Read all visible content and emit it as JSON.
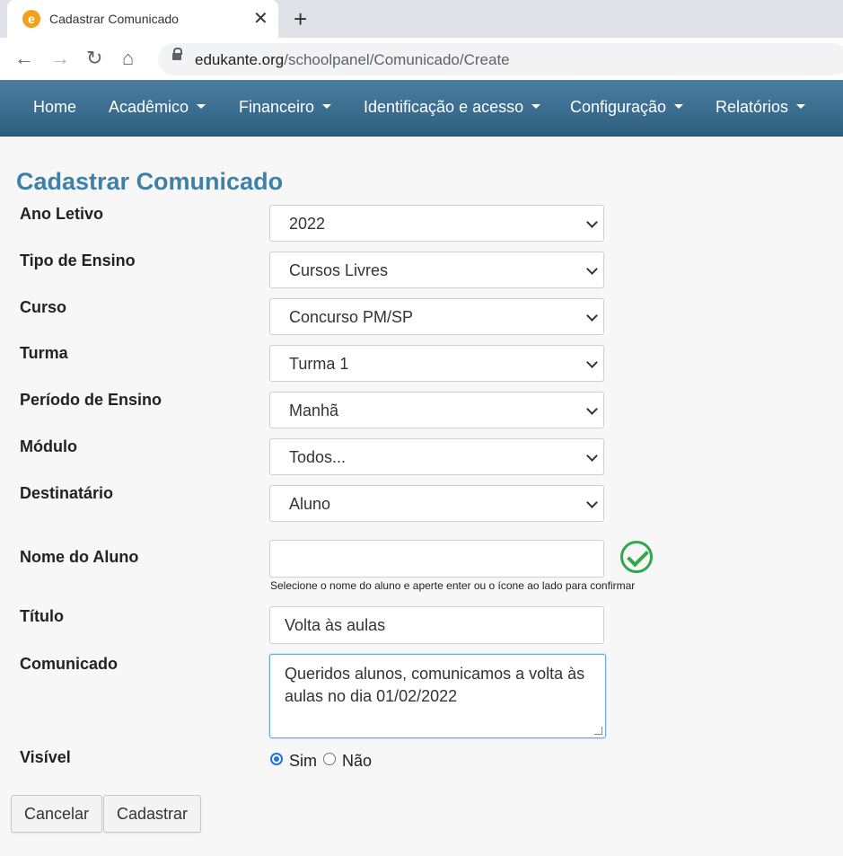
{
  "browser": {
    "tab_title": "Cadastrar Comunicado",
    "favicon_letter": "e",
    "url_host": "edukante.org",
    "url_path": "/schoolpanel/Comunicado/Create",
    "icons": [
      "close-icon",
      "new-tab-icon",
      "back-icon",
      "forward-icon",
      "reload-icon",
      "home-icon",
      "lock-icon"
    ]
  },
  "nav": {
    "items": [
      {
        "label": "Home",
        "dropdown": false
      },
      {
        "label": "Acadêmico",
        "dropdown": true
      },
      {
        "label": "Financeiro",
        "dropdown": true
      },
      {
        "label": "Identificação e acesso",
        "dropdown": true
      },
      {
        "label": "Configuração",
        "dropdown": true
      },
      {
        "label": "Relatórios",
        "dropdown": true
      }
    ]
  },
  "page": {
    "title": "Cadastrar Comunicado",
    "title_color": "#3f80a8"
  },
  "form": {
    "ano_letivo": {
      "label": "Ano Letivo",
      "value": "2022"
    },
    "tipo_ensino": {
      "label": "Tipo de Ensino",
      "value": "Cursos Livres"
    },
    "curso": {
      "label": "Curso",
      "value": "Concurso PM/SP"
    },
    "turma": {
      "label": "Turma",
      "value": "Turma 1"
    },
    "periodo": {
      "label": "Período de Ensino",
      "value": "Manhã"
    },
    "modulo": {
      "label": "Módulo",
      "value": "Todos..."
    },
    "destinatario": {
      "label": "Destinatário",
      "value": "Aluno"
    },
    "nome_aluno": {
      "label": "Nome do Aluno",
      "value": "",
      "help": "Selecione o nome do aluno e aperte enter ou o ícone ao lado para confirmar"
    },
    "titulo": {
      "label": "Título",
      "value": "Volta às aulas"
    },
    "comunicado": {
      "label": "Comunicado",
      "value": "Queridos alunos, comunicamos a volta às aulas no dia 01/02/2022"
    },
    "visivel": {
      "label": "Visível",
      "options": [
        "Sim",
        "Não"
      ],
      "selected": "Sim"
    }
  },
  "buttons": {
    "cancel": "Cancelar",
    "submit": "Cadastrar"
  },
  "colors": {
    "nav_bg": "#3b6f92",
    "accent": "#3f80a8",
    "confirm_green": "#2ea84a"
  }
}
